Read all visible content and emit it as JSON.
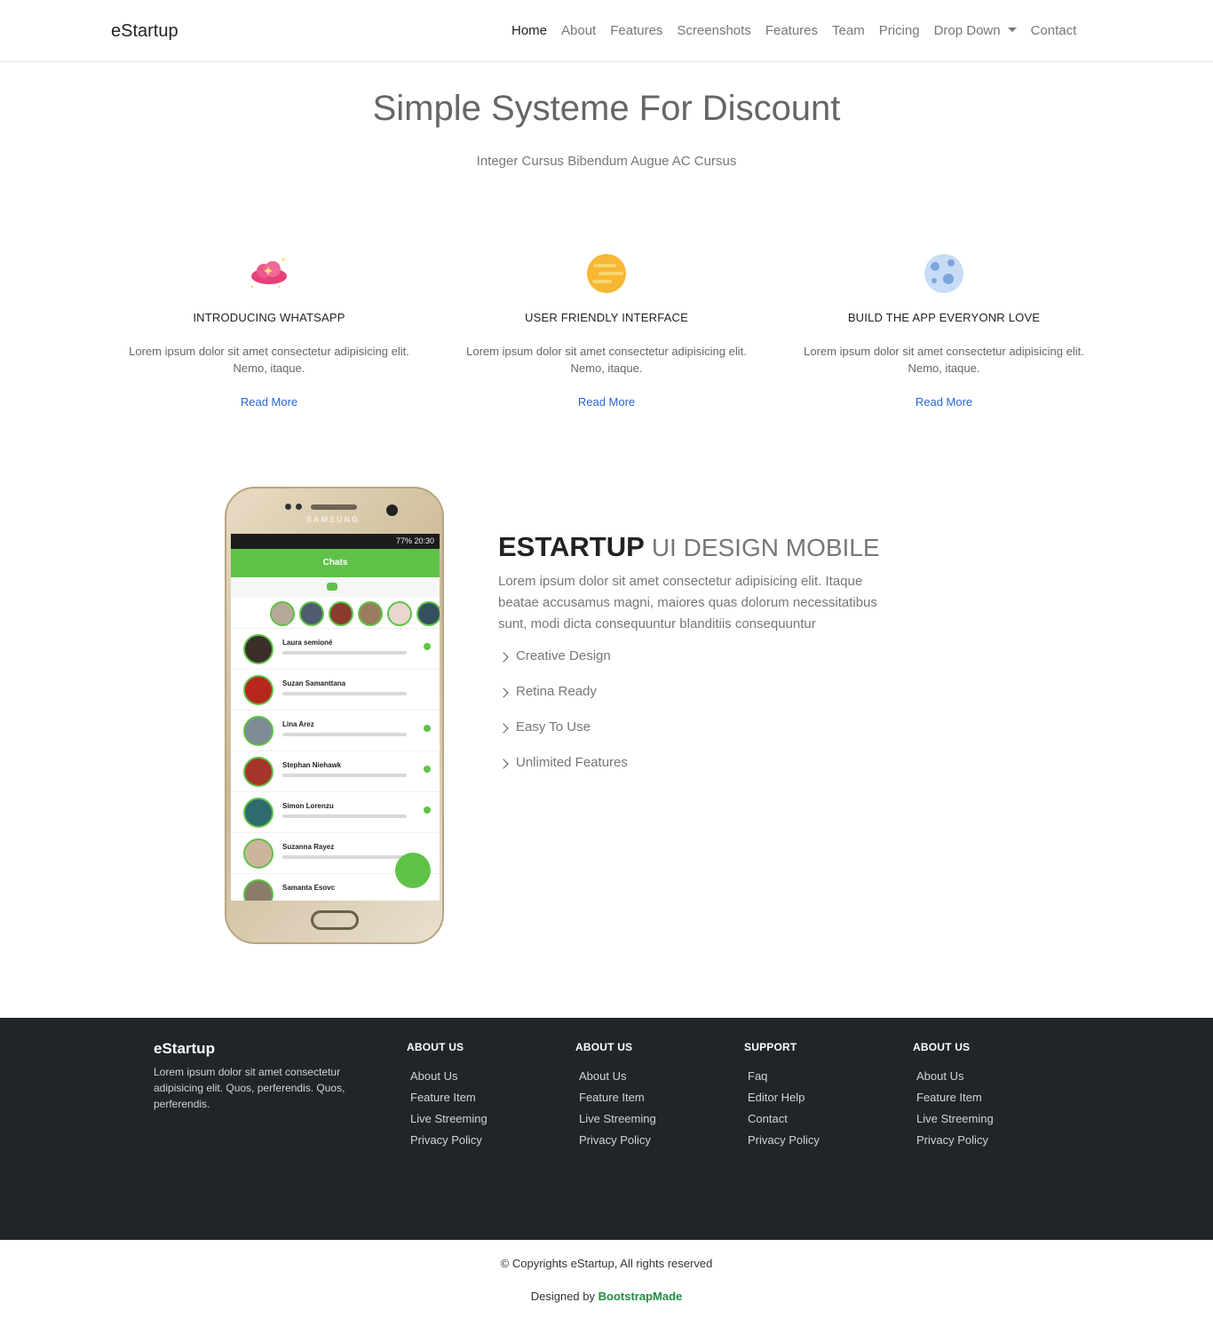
{
  "navbar": {
    "brand": "eStartup",
    "items": [
      {
        "label": "Home"
      },
      {
        "label": "About"
      },
      {
        "label": "Features"
      },
      {
        "label": "Screenshots"
      },
      {
        "label": "Features"
      },
      {
        "label": "Team"
      },
      {
        "label": "Pricing"
      },
      {
        "label": "Drop Down"
      },
      {
        "label": "Contact"
      }
    ]
  },
  "hero": {
    "title": "Simple Systeme For Discount",
    "subtitle": "Integer Cursus Bibendum Augue AC Cursus"
  },
  "features": [
    {
      "icon": "cloud-sparkle-icon",
      "title": "INTRODUCING WHATSAPP",
      "text": "Lorem ipsum dolor sit amet consectetur adipisicing elit. Nemo, itaque.",
      "link": "Read More"
    },
    {
      "icon": "planet-icon",
      "title": "USER FRIENDLY INTERFACE",
      "text": "Lorem ipsum dolor sit amet consectetur adipisicing elit. Nemo, itaque.",
      "link": "Read More"
    },
    {
      "icon": "moon-icon",
      "title": "BUILD THE APP EVERYONR LOVE",
      "text": "Lorem ipsum dolor sit amet consectetur adipisicing elit. Nemo, itaque.",
      "link": "Read More"
    }
  ],
  "phone": {
    "brand": "SAMSUNG",
    "status": "77% 20:30",
    "appbar_title": "Chats",
    "chats": [
      {
        "name": "Laura semioné"
      },
      {
        "name": "Suzan Samanttana"
      },
      {
        "name": "Lina Arez"
      },
      {
        "name": "Stephan Niehawk"
      },
      {
        "name": "Simon Lorenzu"
      },
      {
        "name": "Suzanna Rayez"
      },
      {
        "name": "Samanta Esovc"
      }
    ]
  },
  "showcase": {
    "title_strong": "ESTARTUP",
    "title_light": "UI DESIGN MOBILE",
    "description": "Lorem ipsum dolor sit amet consectetur adipisicing elit. Itaque beatae accusamus magni, maiores quas dolorum necessitatibus sunt, modi dicta consequuntur blanditiis consequuntur",
    "list": [
      "Creative Design",
      "Retina Ready",
      "Easy To Use",
      "Unlimited Features"
    ]
  },
  "footer": {
    "brand": "eStartup",
    "description": "Lorem ipsum dolor sit amet consectetur adipisicing elit. Quos, perferendis. Quos, perferendis.",
    "columns": [
      {
        "heading": "ABOUT US",
        "links": [
          "About Us",
          "Feature Item",
          "Live Streeming",
          "Privacy Policy"
        ]
      },
      {
        "heading": "ABOUT US",
        "links": [
          "About Us",
          "Feature Item",
          "Live Streeming",
          "Privacy Policy"
        ]
      },
      {
        "heading": "SUPPORT",
        "links": [
          "Faq",
          "Editor Help",
          "Contact",
          "Privacy Policy"
        ]
      },
      {
        "heading": "ABOUT US",
        "links": [
          "About Us",
          "Feature Item",
          "Live Streeming",
          "Privacy Policy"
        ]
      }
    ]
  },
  "bottom": {
    "copyright": "© Copyrights eStartup, All rights reserved",
    "designed_prefix": "Designed by",
    "designed_link": "BootstrapMade"
  },
  "colors": {
    "accent_link": "#2767d6",
    "footer_bg": "#212529",
    "credit_link": "#1f8d43",
    "app_green": "#5fc248"
  }
}
